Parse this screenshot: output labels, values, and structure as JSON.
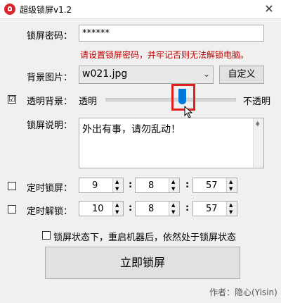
{
  "window": {
    "title": "超级锁屏v1.2",
    "close_symbol": "✕"
  },
  "password": {
    "label": "锁屏密码：",
    "value": "******",
    "hint": "请设置锁屏密码，并牢记否则无法解锁电脑。"
  },
  "background": {
    "label": "背景图片：",
    "selected": "w021.jpg",
    "custom_button": "自定义"
  },
  "transparency": {
    "checked": true,
    "check_mark": "☑",
    "label": "透明背景：",
    "min_label": "透明",
    "max_label": "不透明",
    "level": 0.6
  },
  "description": {
    "label": "锁屏说明：",
    "text": "外出有事，请勿乱动！"
  },
  "timed_lock": {
    "checked": false,
    "label": "定时锁屏：",
    "hour": "9",
    "minute": "8",
    "second": "57"
  },
  "timed_unlock": {
    "checked": false,
    "label": "定时解锁：",
    "hour": "10",
    "minute": "8",
    "second": "57"
  },
  "reboot_option": {
    "checked": false,
    "label": "锁屏状态下，重启机器后，依然处于锁屏状态"
  },
  "lock_now_button": "立即锁屏",
  "author": "作者：隐心(Yisin)",
  "icons": {
    "app": "lock-app-icon",
    "close": "close-icon",
    "dropdown": "chevron-down-icon",
    "cursor": "mouse-pointer-icon"
  }
}
